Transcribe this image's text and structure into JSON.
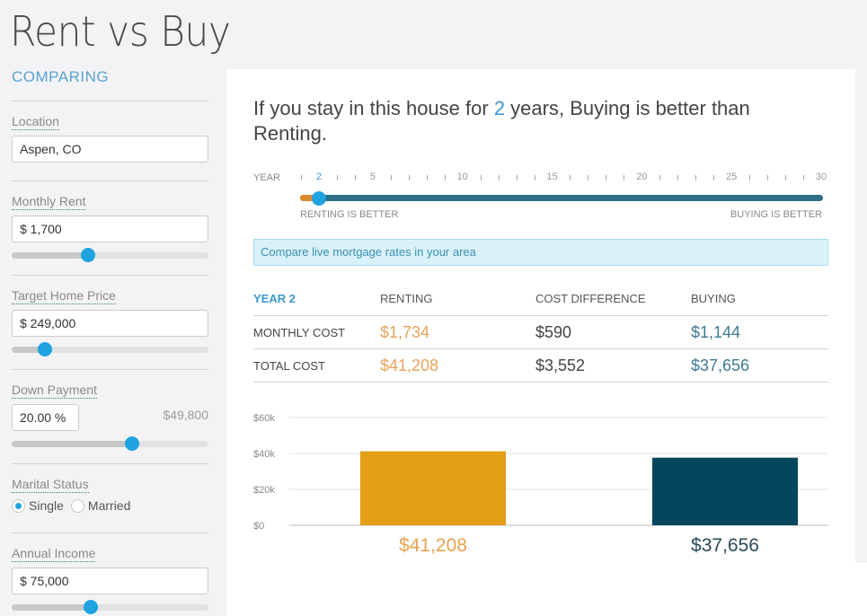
{
  "page_title": "Rent vs Buy",
  "sidebar": {
    "section_title": "COMPARING",
    "location": {
      "label": "Location",
      "value": "Aspen, CO"
    },
    "monthly_rent": {
      "label": "Monthly Rent",
      "value": "$ 1,700",
      "slider_fraction": 0.39
    },
    "home_price": {
      "label": "Target Home Price",
      "value": "$ 249,000",
      "slider_fraction": 0.17
    },
    "down_payment": {
      "label": "Down Payment",
      "value": "20.00  %",
      "amount": "$49,800",
      "slider_fraction": 0.61
    },
    "marital_status": {
      "label": "Marital Status",
      "options": [
        "Single",
        "Married"
      ],
      "selected": "Single"
    },
    "annual_income": {
      "label": "Annual Income",
      "value": "$ 75,000",
      "slider_fraction": 0.4
    }
  },
  "main": {
    "headline_pre": "If you stay in this house for ",
    "headline_years": "2",
    "headline_post": " years, Buying is better than Renting.",
    "year_scale": {
      "label": "YEAR",
      "min": 1,
      "max": 30,
      "selected": 2,
      "labeled_ticks": [
        2,
        5,
        10,
        15,
        20,
        25,
        30
      ],
      "left_caption": "RENTING IS BETTER",
      "right_caption": "BUYING IS BETTER"
    },
    "rates_banner": "Compare live mortgage rates in your area",
    "cost_table": {
      "headers": [
        "YEAR 2",
        "RENTING",
        "COST DIFFERENCE",
        "BUYING"
      ],
      "rows": [
        {
          "label": "MONTHLY COST",
          "renting": "$1,734",
          "difference": "$590",
          "buying": "$1,144"
        },
        {
          "label": "TOTAL COST",
          "renting": "$41,208",
          "difference": "$3,552",
          "buying": "$37,656"
        }
      ]
    },
    "colors": {
      "renting": "#e29e15",
      "buying": "#03475f",
      "accent": "#1ea3df"
    }
  },
  "chart_data": {
    "type": "bar",
    "categories": [
      "Renting",
      "Buying"
    ],
    "values": [
      41208,
      37656
    ],
    "value_labels": [
      "$41,208",
      "$37,656"
    ],
    "yticks": [
      0,
      20000,
      40000,
      60000
    ],
    "ytick_labels": [
      "$0",
      "$20k",
      "$40k",
      "$60k"
    ],
    "ylim": [
      0,
      60000
    ],
    "grid": true,
    "title": "",
    "xlabel": "",
    "ylabel": ""
  }
}
